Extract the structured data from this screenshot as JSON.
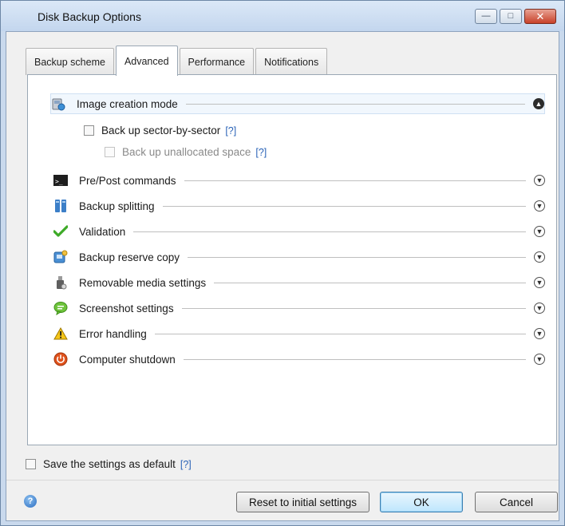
{
  "window": {
    "title": "Disk Backup Options",
    "minimize": "—",
    "maximize": "□",
    "close": "✕"
  },
  "tabs": [
    {
      "label": "Backup scheme",
      "active": false
    },
    {
      "label": "Advanced",
      "active": true
    },
    {
      "label": "Performance",
      "active": false
    },
    {
      "label": "Notifications",
      "active": false
    }
  ],
  "sections": [
    {
      "label": "Image creation mode",
      "icon": "image-disk-icon",
      "expanded": true
    },
    {
      "label": "Pre/Post commands",
      "icon": "terminal-icon",
      "expanded": false
    },
    {
      "label": "Backup splitting",
      "icon": "split-icon",
      "expanded": false
    },
    {
      "label": "Validation",
      "icon": "checkmark-icon",
      "expanded": false
    },
    {
      "label": "Backup reserve copy",
      "icon": "reserve-copy-icon",
      "expanded": false
    },
    {
      "label": "Removable media settings",
      "icon": "usb-drive-icon",
      "expanded": false
    },
    {
      "label": "Screenshot settings",
      "icon": "speech-bubble-icon",
      "expanded": false
    },
    {
      "label": "Error handling",
      "icon": "warning-icon",
      "expanded": false
    },
    {
      "label": "Computer shutdown",
      "icon": "power-icon",
      "expanded": false
    }
  ],
  "image_creation": {
    "sector_by_sector": {
      "label": "Back up sector-by-sector",
      "help": "[?]",
      "checked": false
    },
    "unallocated": {
      "label": "Back up unallocated space",
      "help": "[?]",
      "checked": false,
      "enabled": false
    }
  },
  "footer": {
    "save_default": {
      "label": "Save the settings as default",
      "help": "[?]",
      "checked": false
    },
    "help_glyph": "?",
    "reset_label": "Reset to initial settings",
    "ok_label": "OK",
    "cancel_label": "Cancel"
  },
  "colors": {
    "accent_blue": "#2a63b7",
    "title_bar": "#c3d6ee",
    "highlight_row": "#f1f7fd",
    "close_button": "#c8412a"
  }
}
